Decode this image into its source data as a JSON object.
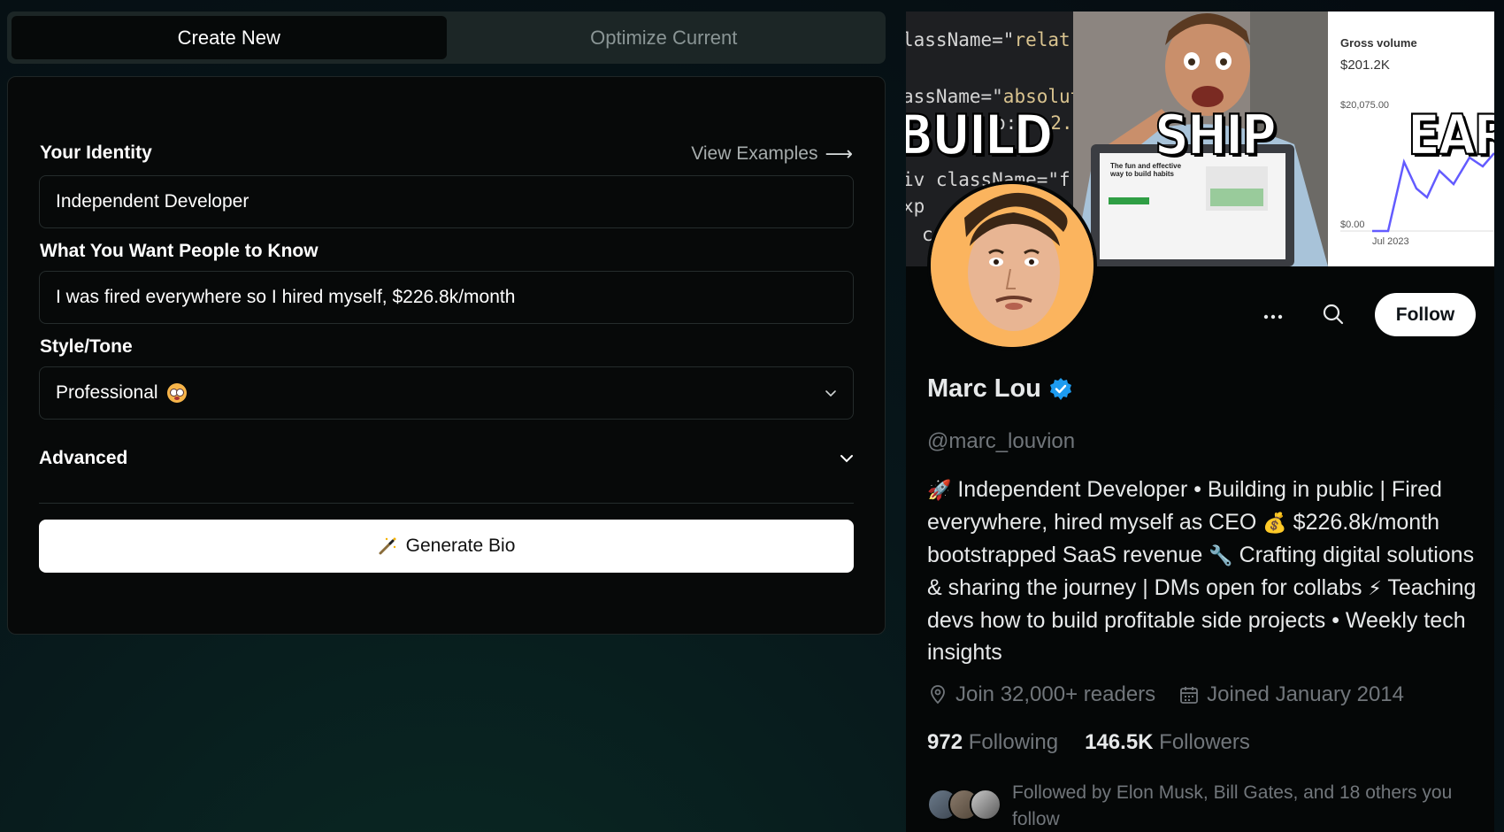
{
  "tabs": [
    {
      "label": "Create New",
      "active": true
    },
    {
      "label": "Optimize Current",
      "active": false
    }
  ],
  "form": {
    "identity_label": "Your Identity",
    "view_examples_label": "View Examples",
    "identity_value": "Independent Developer",
    "know_label": "What You Want People to Know",
    "know_value": "I was fired everywhere so I hired myself, $226.8k/month",
    "style_label": "Style/Tone",
    "style_value": "Professional",
    "advanced_label": "Advanced",
    "generate_label": "Generate Bio"
  },
  "profile": {
    "banner": {
      "code_lines": [
        {
          "pre": "lassName=\"",
          "str": "relat"
        },
        {
          "pre": "assName=\"",
          "str": "absolut"
        },
        {
          "pre": "p: \"",
          "str": "-2."
        },
        {
          "pre": "iv className=\"f",
          "str": ""
        },
        {
          "pre": "xp",
          "str": ""
        },
        {
          "pre": "c",
          "str": ""
        }
      ],
      "word_build": "BUILD",
      "word_ship": "SHIP",
      "word_earn": "EARN",
      "laptop_text": "The fun and effective way to build habits",
      "chart_title": "Gross volume",
      "chart_amount": "$201.2K",
      "chart_ymax": "$20,075.00",
      "chart_ymin": "$0.00",
      "chart_xlabel": "Jul 2023"
    },
    "follow_label": "Follow",
    "name": "Marc Lou",
    "handle": "@marc_louvion",
    "bio": {
      "p1": "Independent Developer • Building in public | Fired everywhere, hired myself as CEO",
      "p2": "$226.8k/month bootstrapped SaaS revenue",
      "p3": "Crafting digital solutions & sharing the journey | DMs open for collabs",
      "p4": "Teaching devs how to build profitable side projects • Weekly tech insights"
    },
    "location": "Join 32,000+ readers",
    "joined": "Joined January 2014",
    "following_count": "972",
    "following_label": "Following",
    "followers_count": "146.5K",
    "followers_label": "Followers",
    "followed_by": "Followed by Elon Musk, Bill Gates, and 18 others you follow"
  },
  "colors": {
    "accent_verified": "#1d9bf0",
    "avatar_bg": "#fbb45e",
    "chart_line": "#635bff"
  },
  "icons": {
    "more": "more-horizontal-icon",
    "search": "search-icon",
    "location": "location-pin-icon",
    "calendar": "calendar-icon",
    "verified": "verified-badge-icon",
    "chevron": "chevron-down-icon",
    "wand": "magic-wand-icon",
    "arrow": "arrow-right-icon"
  }
}
